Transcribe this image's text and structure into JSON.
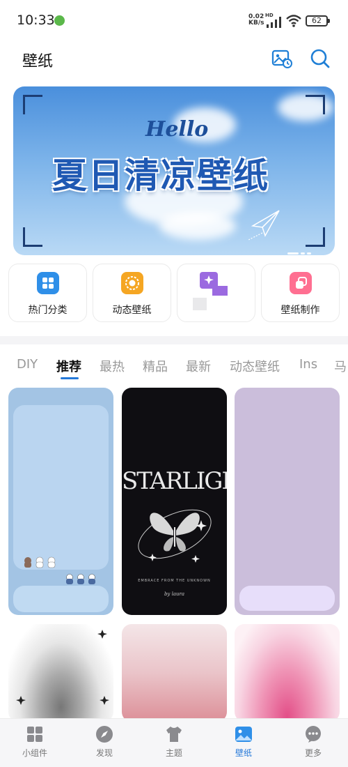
{
  "status_bar": {
    "time": "10:33",
    "net_speed_value": "0.02",
    "net_speed_unit": "KB/s",
    "network_type": "HD",
    "battery": "62"
  },
  "header": {
    "title": "壁纸",
    "icons": [
      "wallpaper-history-icon",
      "search-icon"
    ]
  },
  "banner": {
    "hello": "Hello",
    "headline": "夏日清凉壁纸"
  },
  "shortcuts": [
    {
      "label": "热门分类",
      "icon": "category-grid-icon",
      "color": "#2f8fe8"
    },
    {
      "label": "动态壁纸",
      "icon": "live-wallpaper-icon",
      "color": "#f5a623"
    },
    {
      "label": "",
      "icon": "magic-wand-icon",
      "color": "#9b6ae0"
    },
    {
      "label": "壁纸制作",
      "icon": "wallpaper-maker-icon",
      "color": "#ff6f91"
    }
  ],
  "tabs": [
    "DIY",
    "推荐",
    "最热",
    "精品",
    "最新",
    "动态壁纸",
    "Ins",
    "马"
  ],
  "active_tab": "推荐",
  "grid": {
    "tile2": {
      "title": "STARLIGHT",
      "caption": "EMBRACE FROM THE UNKNOWN",
      "signature": "by laura"
    }
  },
  "bottom_nav": [
    {
      "label": "小组件",
      "icon": "widget-icon"
    },
    {
      "label": "发现",
      "icon": "compass-icon"
    },
    {
      "label": "主题",
      "icon": "tshirt-icon"
    },
    {
      "label": "壁纸",
      "icon": "wallpaper-icon"
    },
    {
      "label": "更多",
      "icon": "more-icon"
    }
  ],
  "active_nav": "壁纸",
  "colors": {
    "accent": "#2478d8",
    "banner_text": "#1f59b3"
  }
}
